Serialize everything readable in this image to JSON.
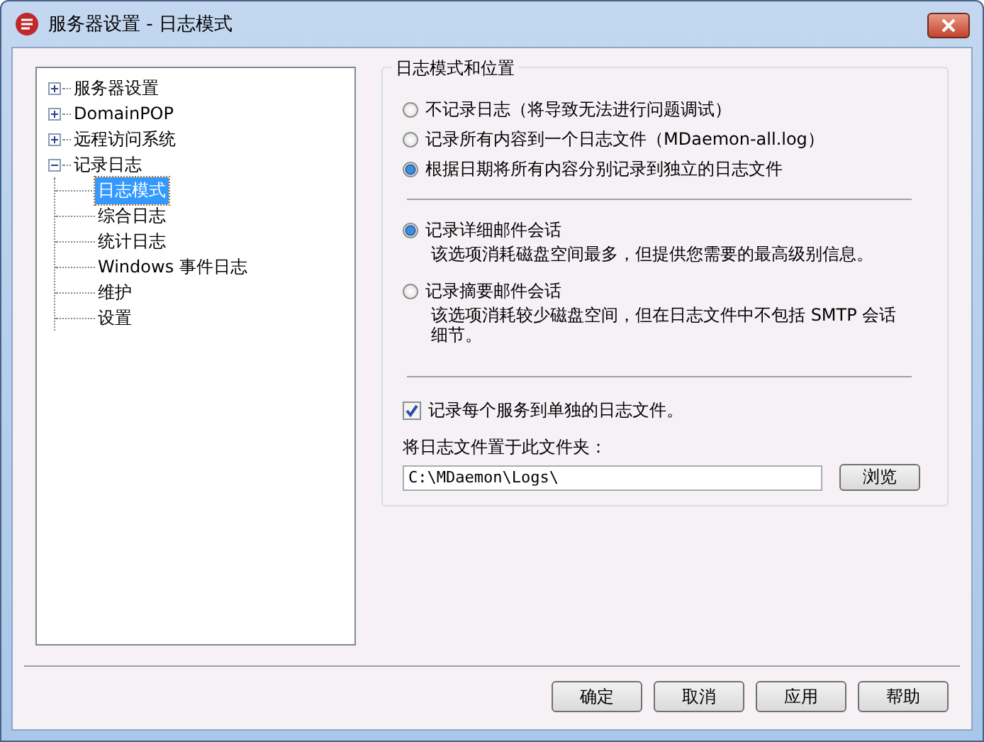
{
  "window": {
    "title": "服务器设置 - 日志模式"
  },
  "tree": [
    {
      "label": "服务器设置",
      "expanded": false,
      "selected": false
    },
    {
      "label": "DomainPOP",
      "expanded": false,
      "selected": false
    },
    {
      "label": "远程访问系统",
      "expanded": false,
      "selected": false
    },
    {
      "label": "记录日志",
      "expanded": true,
      "selected": false,
      "children": [
        {
          "label": "日志模式",
          "selected": true
        },
        {
          "label": "综合日志",
          "selected": false
        },
        {
          "label": "统计日志",
          "selected": false
        },
        {
          "label": "Windows 事件日志",
          "selected": false
        },
        {
          "label": "维护",
          "selected": false
        },
        {
          "label": "设置",
          "selected": false
        }
      ]
    }
  ],
  "group": {
    "title": "日志模式和位置"
  },
  "log_modes": [
    {
      "label": "不记录日志（将导致无法进行问题调试）",
      "selected": false
    },
    {
      "label": "记录所有内容到一个日志文件（MDaemon-all.log）",
      "selected": false
    },
    {
      "label": "根据日期将所有内容分别记录到独立的日志文件",
      "selected": true
    }
  ],
  "detail_modes": [
    {
      "label": "记录详细邮件会话",
      "description": "该选项消耗磁盘空间最多，但提供您需要的最高级别信息。",
      "selected": true
    },
    {
      "label": "记录摘要邮件会话",
      "description": "该选项消耗较少磁盘空间，但在日志文件中不包括 SMTP 会话细节。",
      "selected": false
    }
  ],
  "separate_files": {
    "label": "记录每个服务到单独的日志文件。",
    "checked": true
  },
  "folder": {
    "label": "将日志文件置于此文件夹：",
    "value": "C:\\MDaemon\\Logs\\"
  },
  "browse_button": "浏览",
  "buttons": [
    "确定",
    "取消",
    "应用",
    "帮助"
  ]
}
